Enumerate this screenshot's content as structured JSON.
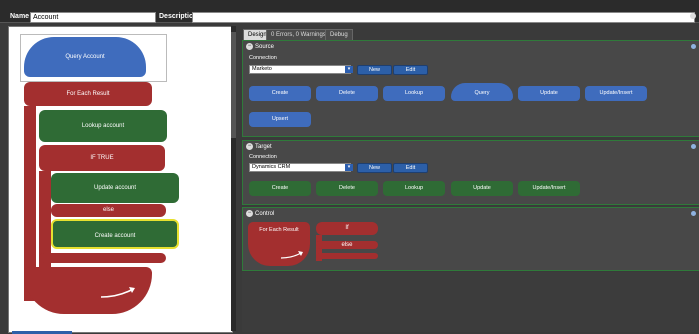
{
  "header": {
    "name_label": "Name",
    "name_value": "Account",
    "description_label": "Description",
    "description_value": ""
  },
  "canvas": {
    "query_block": "Query Account",
    "foreach_block": "For Each Result",
    "lookup_block": "Lookup account",
    "if_block": "IF TRUE",
    "update_block": "Update account",
    "else_block": "else",
    "create_block": "Create account"
  },
  "tabs": [
    {
      "label": "Design"
    },
    {
      "label": "0 Errors, 0 Warnings"
    },
    {
      "label": "Debug"
    }
  ],
  "source": {
    "title": "Source",
    "connection_label": "Connection",
    "connection_value": "Marketo",
    "new_label": "New",
    "edit_label": "Edit",
    "blocks": [
      "Create",
      "Delete",
      "Lookup",
      "Query",
      "Update",
      "Update/Insert",
      "Upsert"
    ]
  },
  "target": {
    "title": "Target",
    "connection_label": "Connection",
    "connection_value": "Dynamics CRM",
    "new_label": "New",
    "edit_label": "Edit",
    "blocks": [
      "Create",
      "Delete",
      "Lookup",
      "Update",
      "Update/Insert"
    ]
  },
  "control": {
    "title": "Control",
    "foreach_label": "For Each Result",
    "if_label": "If",
    "else_label": "else"
  },
  "icons": {
    "collapse": "minus-circle-icon",
    "info": "info-dot-icon",
    "dropdown": "chevron-down-icon",
    "loop": "loop-arrow-icon"
  },
  "colors": {
    "source_blue": "#3f6cbd",
    "target_green": "#2f6b35",
    "control_red": "#a32f2f"
  }
}
